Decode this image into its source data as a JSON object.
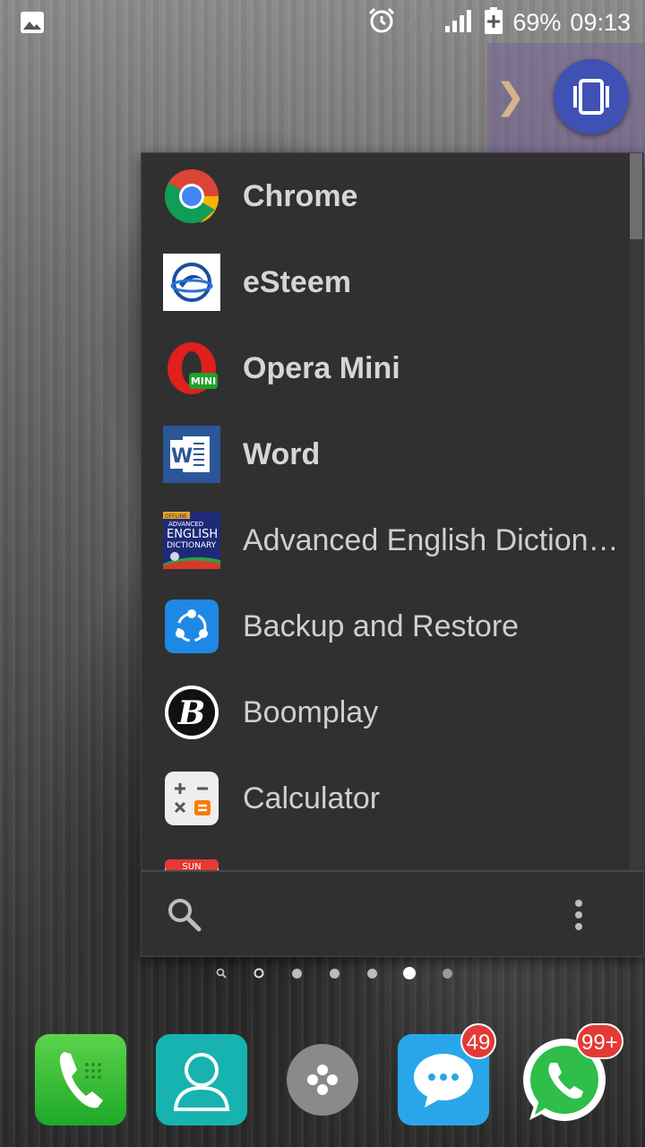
{
  "status_bar": {
    "battery": "69%",
    "time": "09:13",
    "icons": [
      "gallery-icon",
      "alarm-icon",
      "signal-icon",
      "signal-icon",
      "battery-charging-icon"
    ]
  },
  "app_drawer": {
    "apps": [
      {
        "label": "Chrome",
        "icon": "chrome-icon",
        "bold": true
      },
      {
        "label": "eSteem",
        "icon": "esteem-icon",
        "bold": true
      },
      {
        "label": "Opera Mini",
        "icon": "opera-mini-icon",
        "bold": true,
        "icon_text": "MINI"
      },
      {
        "label": "Word",
        "icon": "word-icon",
        "bold": true
      },
      {
        "label": "Advanced English Dictionary",
        "icon": "dictionary-icon",
        "bold": false,
        "icon_text_1": "OFFLINE",
        "icon_text_2": "ADVANCED",
        "icon_text_3": "ENGLISH",
        "icon_text_4": "DICTIONARY"
      },
      {
        "label": "Backup and Restore",
        "icon": "backup-icon",
        "bold": false
      },
      {
        "label": "Boomplay",
        "icon": "boomplay-icon",
        "bold": false
      },
      {
        "label": "Calculator",
        "icon": "calculator-icon",
        "bold": false
      },
      {
        "label": "",
        "icon": "calendar-icon",
        "bold": false,
        "icon_text": "SUN"
      }
    ],
    "scroll_position": 0.0
  },
  "page_indicator": {
    "count": 7,
    "active_index": 5
  },
  "dock": {
    "apps": [
      {
        "name": "Phone",
        "icon": "phone-icon"
      },
      {
        "name": "Contacts",
        "icon": "contacts-icon"
      },
      {
        "name": "App Drawer",
        "icon": "app-drawer-icon"
      },
      {
        "name": "Messages",
        "icon": "messages-icon",
        "badge": "49"
      },
      {
        "name": "WhatsApp",
        "icon": "whatsapp-icon",
        "badge": "99+"
      }
    ]
  },
  "colors": {
    "popup_bg": "#303030",
    "switcher_blue": "#3f51b5",
    "badge_red": "#e53935"
  }
}
